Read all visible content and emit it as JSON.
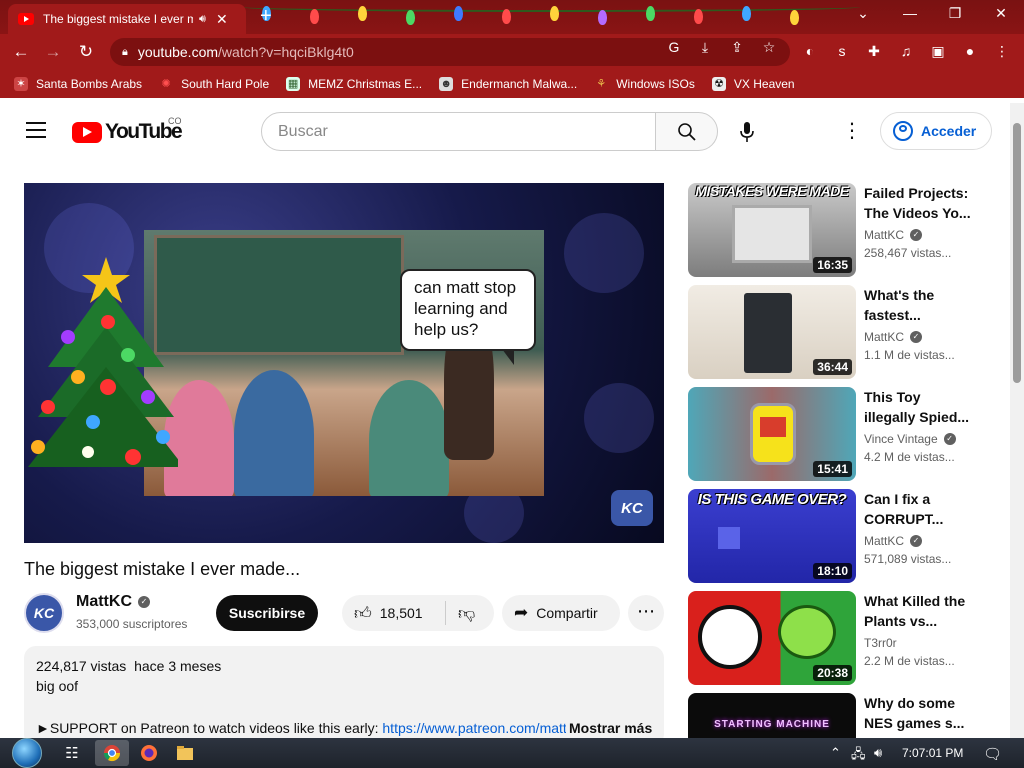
{
  "browser": {
    "tab_title": "The biggest mistake I ever m",
    "url_host": "youtube.com",
    "url_path": "/watch?v=hqciBklg4t0",
    "bookmarks": [
      {
        "label": "Santa Bombs Arabs",
        "icon": "santa-icon"
      },
      {
        "label": "South Hard Pole",
        "icon": "snowflake-icon"
      },
      {
        "label": "MEMZ Christmas E...",
        "icon": "memz-icon"
      },
      {
        "label": "Endermanch Malwa...",
        "icon": "raccoon-icon"
      },
      {
        "label": "Windows ISOs",
        "icon": "windows-icon"
      },
      {
        "label": "VX Heaven",
        "icon": "vx-icon"
      }
    ]
  },
  "youtube": {
    "logo_text": "YouTube",
    "country": "CO",
    "search_placeholder": "Buscar",
    "signin_label": "Acceder",
    "bubble_text": "can matt stop learning and help us?",
    "watermark": "KC",
    "video_title": "The biggest mistake I ever made...",
    "channel": {
      "name": "MattKC",
      "subscribers": "353,000 suscriptores",
      "avatar_text": "KC"
    },
    "subscribe_label": "Suscribirse",
    "like_count": "18,501",
    "share_label": "Compartir",
    "description": {
      "views": "224,817 vistas",
      "age": "hace 3 meses",
      "line1": "big oof",
      "support_prefix": "►SUPPORT on Patreon to watch videos like this early: ",
      "support_link": "https://www.patreon.com/mattkc",
      "show_more": "Mostrar más"
    },
    "related": [
      {
        "title": "Failed Projects: The Videos Yo...",
        "channel": "MattKC",
        "views": "258,467 vistas...",
        "duration": "16:35",
        "overlay": "MISTAKES WERE MADE"
      },
      {
        "title": "What's the fastest...",
        "channel": "MattKC",
        "views": "1.1 M de vistas...",
        "duration": "36:44",
        "overlay": ""
      },
      {
        "title": "This Toy illegally Spied...",
        "channel": "Vince Vintage",
        "views": "4.2 M de vistas...",
        "duration": "15:41",
        "overlay": ""
      },
      {
        "title": "Can I fix a CORRUPT...",
        "channel": "MattKC",
        "views": "571,089 vistas...",
        "duration": "18:10",
        "overlay": "IS THIS GAME OVER?"
      },
      {
        "title": "What Killed the Plants vs...",
        "channel": "T3rr0r",
        "views": "2.2 M de vistas...",
        "duration": "20:38",
        "overlay": ""
      },
      {
        "title": "Why do some NES games s...",
        "channel": "",
        "views": "",
        "duration": "",
        "overlay": "STARTING MACHINE"
      }
    ]
  },
  "taskbar": {
    "clock": "7:07:01 PM"
  }
}
